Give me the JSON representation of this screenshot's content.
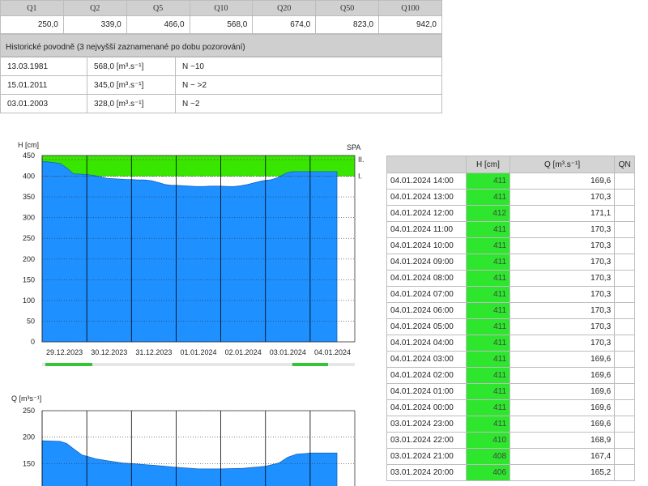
{
  "discharge_table": {
    "headers": [
      "Q1",
      "Q2",
      "Q5",
      "Q10",
      "Q20",
      "Q50",
      "Q100"
    ],
    "values": [
      "250,0",
      "339,0",
      "466,0",
      "568,0",
      "674,0",
      "823,0",
      "942,0"
    ]
  },
  "historical": {
    "title": "Historické povodně (3 nejvyšší zaznamenané po dobu pozorování)",
    "rows": [
      {
        "date": "13.03.1981",
        "value": "568,0 [m³.s⁻¹]",
        "note": "N ~10"
      },
      {
        "date": "15.01.2011",
        "value": "345,0 [m³.s⁻¹]",
        "note": "N ~ >2"
      },
      {
        "date": "03.01.2003",
        "value": "328,0 [m³.s⁻¹]",
        "note": "N ~2"
      }
    ]
  },
  "colors": {
    "level_fill": "#1e90ff",
    "green_band": "#39e600",
    "cell_green": "#2ee62e"
  },
  "chart_data": [
    {
      "type": "area",
      "ylabel": "H [cm]",
      "ylim": [
        0,
        450
      ],
      "yticks": [
        0,
        50,
        100,
        150,
        200,
        250,
        300,
        350,
        400,
        450
      ],
      "xlabels": [
        "29.12.2023",
        "30.12.2023",
        "31.12.2023",
        "01.01.2024",
        "02.01.2024",
        "03.01.2024",
        "04.01.2024"
      ],
      "spa_label": "SPA",
      "spa_levels": [
        {
          "label": "I.",
          "value": 400
        },
        {
          "label": "II.",
          "value": 440
        }
      ],
      "x": [
        0,
        0.1,
        0.25,
        0.4,
        0.55,
        0.7,
        0.85,
        1,
        1.15,
        1.3,
        1.45,
        1.6,
        1.75,
        1.9,
        2,
        2.15,
        2.3,
        2.45,
        2.6,
        2.75,
        2.9,
        3,
        3.15,
        3.3,
        3.45,
        3.6,
        3.75,
        3.9,
        4,
        4.15,
        4.3,
        4.45,
        4.6,
        4.75,
        4.9,
        5,
        5.1,
        5.2,
        5.3,
        5.4,
        5.5,
        5.6,
        5.7,
        5.8,
        5.9,
        6,
        6.1,
        6.2,
        6.3,
        6.4,
        6.55,
        6.6
      ],
      "values": [
        435,
        435,
        433,
        431,
        420,
        406,
        405,
        404,
        402,
        399,
        395,
        394,
        393,
        392,
        392,
        391,
        391,
        389,
        385,
        380,
        378,
        378,
        377,
        376,
        375,
        375,
        376,
        376,
        376,
        375,
        375,
        377,
        380,
        384,
        388,
        390,
        391,
        394,
        398,
        404,
        409,
        411,
        411,
        411,
        411,
        411,
        411,
        411,
        411,
        411,
        411,
        411
      ]
    },
    {
      "type": "area",
      "ylabel": "Q [m³s⁻¹]",
      "ylim": [
        100,
        250
      ],
      "yticks": [
        150,
        200,
        250
      ],
      "x": [
        0,
        0.4,
        0.55,
        0.7,
        0.9,
        1,
        1.2,
        1.5,
        1.8,
        2,
        2.3,
        2.6,
        3,
        3.5,
        4,
        4.5,
        5,
        5.3,
        5.5,
        5.7,
        5.9,
        6,
        6.2,
        6.4,
        6.6
      ],
      "values": [
        193,
        192,
        188,
        178,
        166,
        164,
        159,
        155,
        151,
        150,
        148,
        146,
        143,
        140,
        140,
        141,
        145,
        151,
        162,
        168,
        169,
        170,
        170,
        170,
        170
      ]
    }
  ],
  "data_table": {
    "headers": {
      "datetime": "",
      "h": "H [cm]",
      "q": "Q [m³.s⁻¹]",
      "qn": "QN"
    },
    "rows": [
      {
        "dt": "04.01.2024 14:00",
        "h": "411",
        "q": "169,6"
      },
      {
        "dt": "04.01.2024 13:00",
        "h": "411",
        "q": "170,3"
      },
      {
        "dt": "04.01.2024 12:00",
        "h": "412",
        "q": "171,1"
      },
      {
        "dt": "04.01.2024 11:00",
        "h": "411",
        "q": "170,3"
      },
      {
        "dt": "04.01.2024 10:00",
        "h": "411",
        "q": "170,3"
      },
      {
        "dt": "04.01.2024 09:00",
        "h": "411",
        "q": "170,3"
      },
      {
        "dt": "04.01.2024 08:00",
        "h": "411",
        "q": "170,3"
      },
      {
        "dt": "04.01.2024 07:00",
        "h": "411",
        "q": "170,3"
      },
      {
        "dt": "04.01.2024 06:00",
        "h": "411",
        "q": "170,3"
      },
      {
        "dt": "04.01.2024 05:00",
        "h": "411",
        "q": "170,3"
      },
      {
        "dt": "04.01.2024 04:00",
        "h": "411",
        "q": "170,3"
      },
      {
        "dt": "04.01.2024 03:00",
        "h": "411",
        "q": "169,6"
      },
      {
        "dt": "04.01.2024 02:00",
        "h": "411",
        "q": "169,6"
      },
      {
        "dt": "04.01.2024 01:00",
        "h": "411",
        "q": "169,6"
      },
      {
        "dt": "04.01.2024 00:00",
        "h": "411",
        "q": "169,6"
      },
      {
        "dt": "03.01.2024 23:00",
        "h": "411",
        "q": "169,6"
      },
      {
        "dt": "03.01.2024 22:00",
        "h": "410",
        "q": "168,9"
      },
      {
        "dt": "03.01.2024 21:00",
        "h": "408",
        "q": "167,4"
      },
      {
        "dt": "03.01.2024 20:00",
        "h": "406",
        "q": "165,2"
      }
    ]
  }
}
